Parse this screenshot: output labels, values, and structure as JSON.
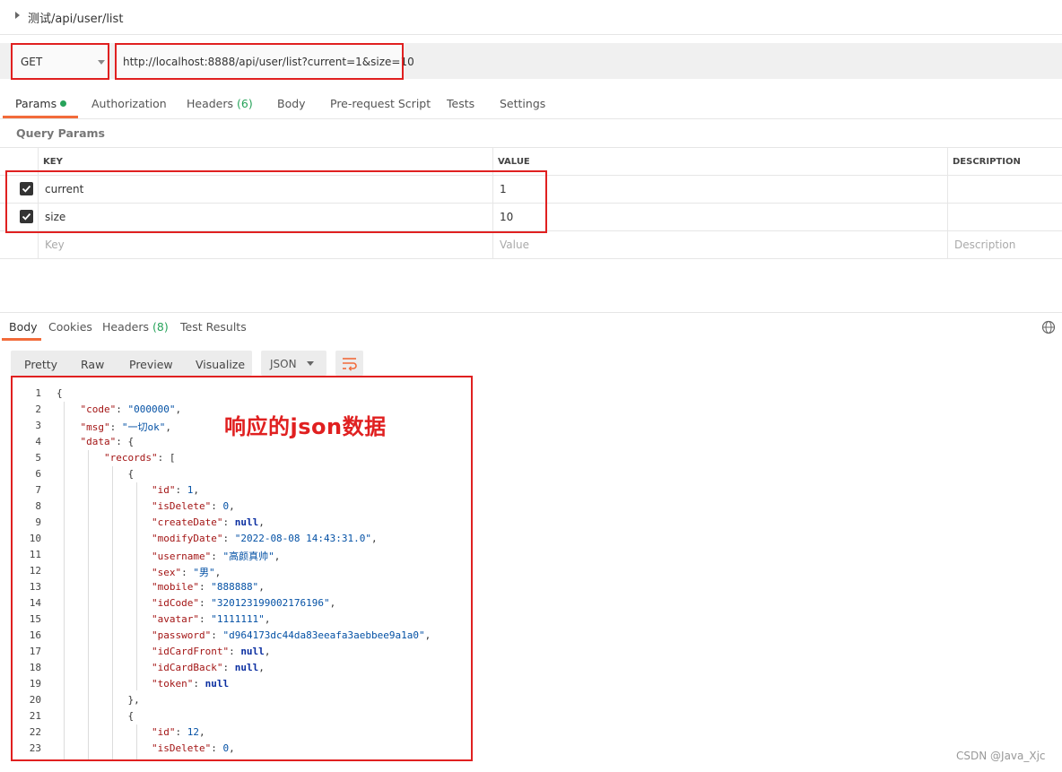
{
  "request": {
    "title": "测试/api/user/list",
    "method": "GET",
    "url": "http://localhost:8888/api/user/list?current=1&size=10"
  },
  "request_tabs": [
    {
      "label": "Params",
      "count": ""
    },
    {
      "label": "Authorization",
      "count": ""
    },
    {
      "label": "Headers",
      "count": "(6)"
    },
    {
      "label": "Body",
      "count": ""
    },
    {
      "label": "Pre-request Script",
      "count": ""
    },
    {
      "label": "Tests",
      "count": ""
    },
    {
      "label": "Settings",
      "count": ""
    }
  ],
  "query_params": {
    "title": "Query Params",
    "columns": [
      "KEY",
      "VALUE",
      "DESCRIPTION"
    ],
    "rows": [
      {
        "key": "current",
        "value": "1",
        "checked": true
      },
      {
        "key": "size",
        "value": "10",
        "checked": true
      }
    ],
    "placeholders": {
      "key": "Key",
      "value": "Value",
      "description": "Description"
    }
  },
  "response_tabs": [
    {
      "label": "Body",
      "count": ""
    },
    {
      "label": "Cookies",
      "count": ""
    },
    {
      "label": "Headers",
      "count": "(8)"
    },
    {
      "label": "Test Results",
      "count": ""
    }
  ],
  "view_modes": [
    "Pretty",
    "Raw",
    "Preview",
    "Visualize"
  ],
  "format": "JSON",
  "icons": {
    "globe": "globe-icon",
    "wrap": "wrap-lines-icon",
    "check": "checkbox-checked-icon"
  },
  "colors": {
    "accent": "#f26b3a",
    "annotation": "#e02020",
    "count": "#27a35a"
  },
  "code_lines": [
    "{",
    "    \"code\": \"000000\",",
    "    \"msg\": \"一切ok\",",
    "    \"data\": {",
    "        \"records\": [",
    "            {",
    "                \"id\": 1,",
    "                \"isDelete\": 0,",
    "                \"createDate\": null,",
    "                \"modifyDate\": \"2022-08-08 14:43:31.0\",",
    "                \"username\": \"高颜真帅\",",
    "                \"sex\": \"男\",",
    "                \"mobile\": \"888888\",",
    "                \"idCode\": \"320123199002176196\",",
    "                \"avatar\": \"1111111\",",
    "                \"password\": \"d964173dc44da83eeafa3aebbee9a1a0\",",
    "                \"idCardFront\": null,",
    "                \"idCardBack\": null,",
    "                \"token\": null",
    "            },",
    "            {",
    "                \"id\": 12,",
    "                \"isDelete\": 0,"
  ],
  "annotation": "响应的json数据",
  "watermark": "CSDN @Java_Xjc"
}
